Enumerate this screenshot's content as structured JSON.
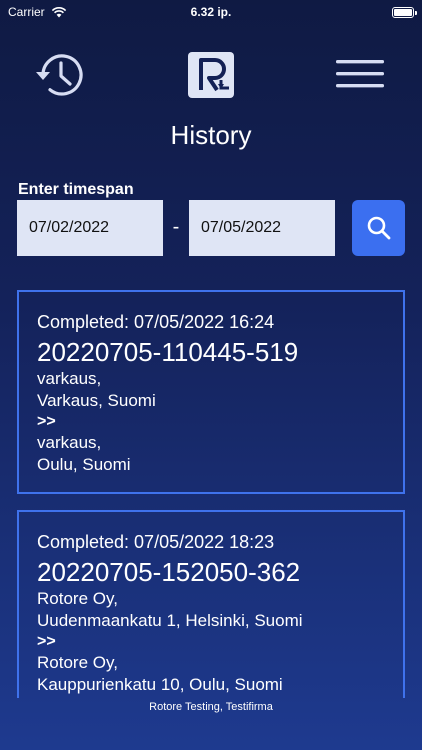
{
  "status_bar": {
    "carrier": "Carrier",
    "time": "6.32 ip."
  },
  "header": {
    "title": "History"
  },
  "timespan": {
    "label": "Enter timespan",
    "start_date": "07/02/2022",
    "separator": "-",
    "end_date": "07/05/2022"
  },
  "history": [
    {
      "completed": "Completed: 07/05/2022 16:24",
      "id": "20220705-110445-519",
      "from_name": "varkaus,",
      "from_address": "Varkaus, Suomi",
      "arrow": ">>",
      "to_name": "varkaus,",
      "to_address": "Oulu, Suomi"
    },
    {
      "completed": "Completed: 07/05/2022 18:23",
      "id": "20220705-152050-362",
      "from_name": "Rotore Oy,",
      "from_address": "Uudenmaankatu 1, Helsinki, Suomi",
      "arrow": ">>",
      "to_name": "Rotore Oy,",
      "to_address": "Kauppurienkatu 10, Oulu, Suomi"
    }
  ],
  "footer": {
    "text": "Rotore Testing, Testifirma"
  },
  "colors": {
    "accent": "#3b6ff0",
    "card_border": "#3f72ec",
    "input_bg": "#dfe5f5"
  },
  "icons": {
    "history": "history-clock-icon",
    "logo": "rotore-logo-icon",
    "menu": "hamburger-menu-icon",
    "search": "search-icon",
    "wifi": "wifi-icon",
    "battery": "battery-icon"
  }
}
